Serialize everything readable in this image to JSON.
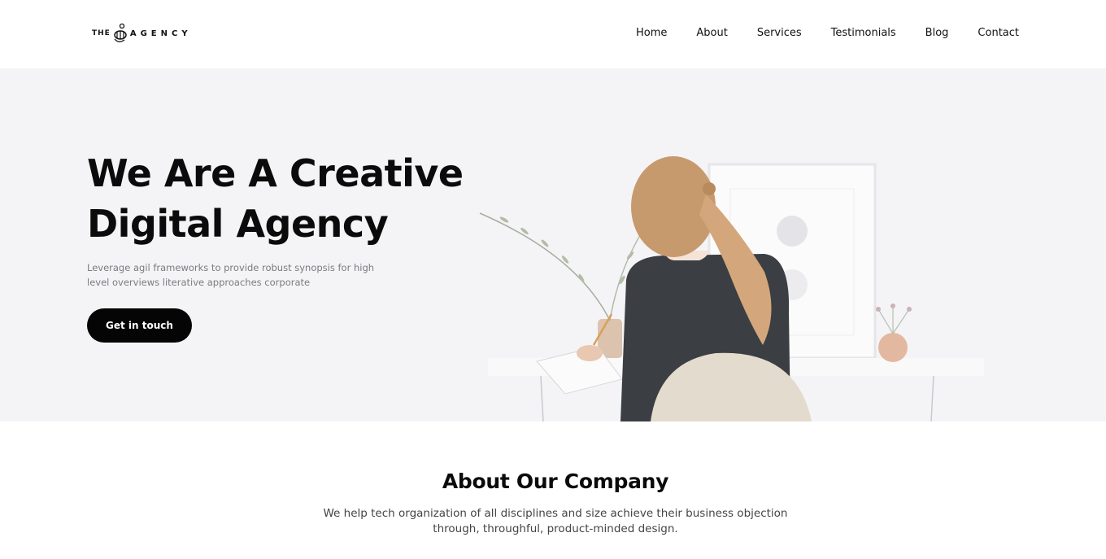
{
  "header": {
    "logo": {
      "prefix": "THE",
      "name": "AGENCY"
    },
    "nav": [
      {
        "label": "Home"
      },
      {
        "label": "About"
      },
      {
        "label": "Services"
      },
      {
        "label": "Testimonials"
      },
      {
        "label": "Blog"
      },
      {
        "label": "Contact"
      }
    ]
  },
  "hero": {
    "title_line1": "We Are A Creative",
    "title_line2": "Digital Agency",
    "subtitle_line1": "Leverage agil frameworks to provide robust synopsis for high",
    "subtitle_line2": "level overviews literative approaches corporate",
    "cta_label": "Get in touch",
    "background_color": "#f4f4f6"
  },
  "about": {
    "title": "About Our Company",
    "text_line1": "We help tech organization of all disciplines and size achieve their business objection",
    "text_line2": "through, throughful, product-minded design."
  },
  "colors": {
    "primary_text": "#0b0b0b",
    "button_bg": "#050505",
    "button_text": "#ffffff",
    "muted_text": "#7b7b80"
  }
}
